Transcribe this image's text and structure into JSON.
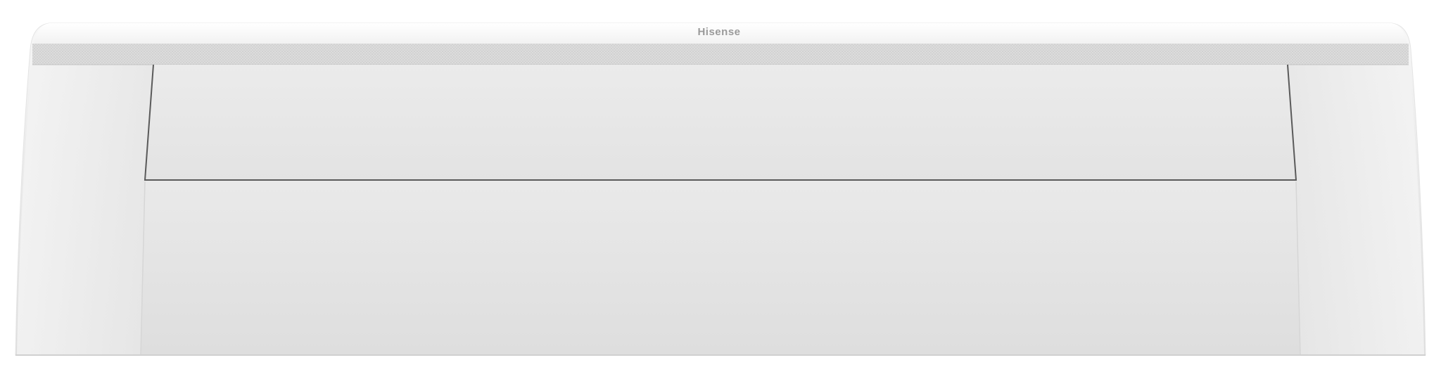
{
  "product": {
    "brand_logo_text": "Hisense",
    "body_color": "#e2e2e2",
    "vent_grille_color": "#cfcfcf",
    "background_color": "#ffffff"
  }
}
